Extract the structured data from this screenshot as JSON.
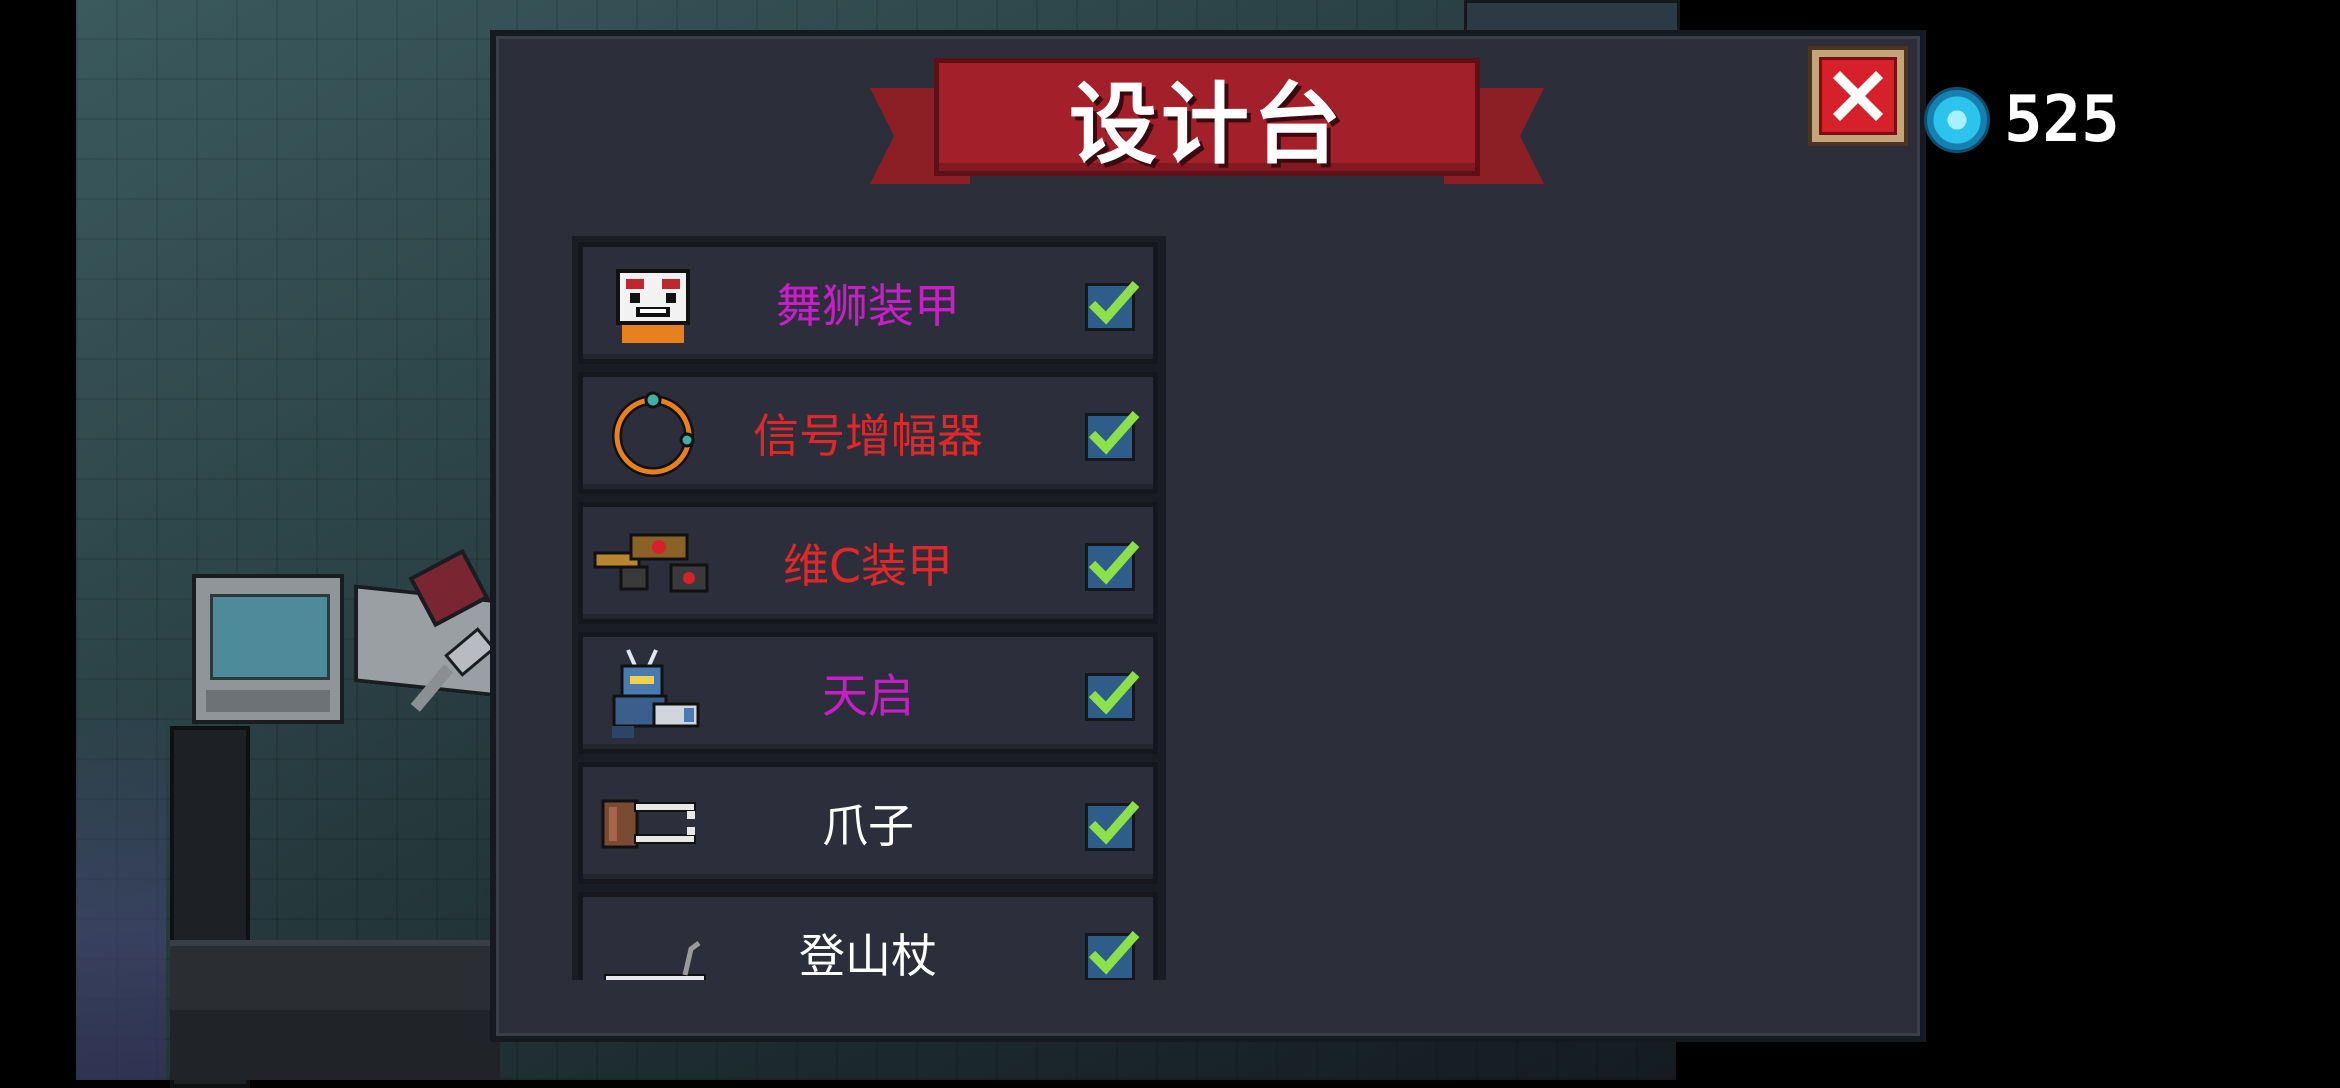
{
  "header": {
    "title": "设计台",
    "close_label": "close",
    "currency": {
      "icon": "gem-icon",
      "amount": "525",
      "color": "#2cc4ec"
    }
  },
  "colors": {
    "title_banner": "#a3202b",
    "panel": "#2c2f3a",
    "rarity_magenta": "#c81ec8",
    "rarity_red": "#e02828",
    "rarity_white": "#ffffff",
    "check_green": "#8ee04a"
  },
  "items": [
    {
      "name": "舞狮装甲",
      "color": "#c81ec8",
      "icon": "lion-dance-armor-icon",
      "checked": true
    },
    {
      "name": "信号增幅器",
      "color": "#e02828",
      "icon": "signal-amplifier-icon",
      "checked": true
    },
    {
      "name": "维C装甲",
      "color": "#e02828",
      "icon": "vitamin-c-armor-icon",
      "checked": true
    },
    {
      "name": "天启",
      "color": "#c81ec8",
      "icon": "apocalypse-mech-icon",
      "checked": true
    },
    {
      "name": "爪子",
      "color": "#ffffff",
      "icon": "claw-icon",
      "checked": true
    },
    {
      "name": "登山杖",
      "color": "#ffffff",
      "icon": "trekking-pole-icon",
      "checked": true
    }
  ]
}
